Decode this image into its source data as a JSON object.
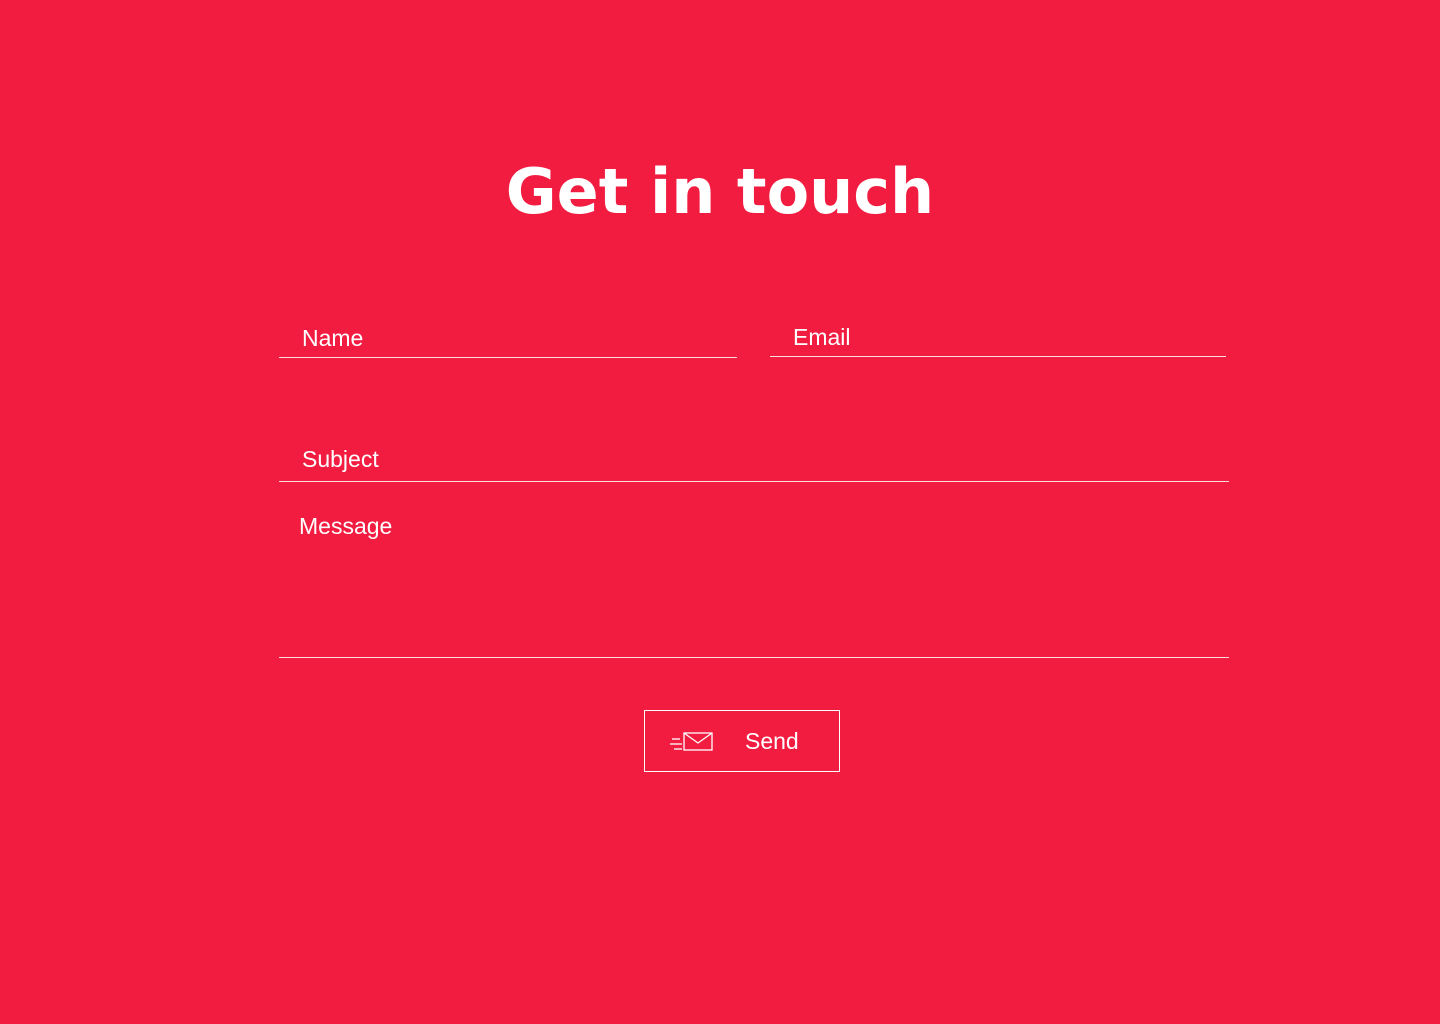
{
  "page": {
    "title": "Get in touch"
  },
  "form": {
    "name_placeholder": "Name",
    "email_placeholder": "Email",
    "subject_placeholder": "Subject",
    "message_placeholder": "Message",
    "send_label": "Send",
    "send_icon": "send-mail-icon"
  },
  "colors": {
    "background": "#F21C41",
    "foreground": "#FFFFFF"
  }
}
